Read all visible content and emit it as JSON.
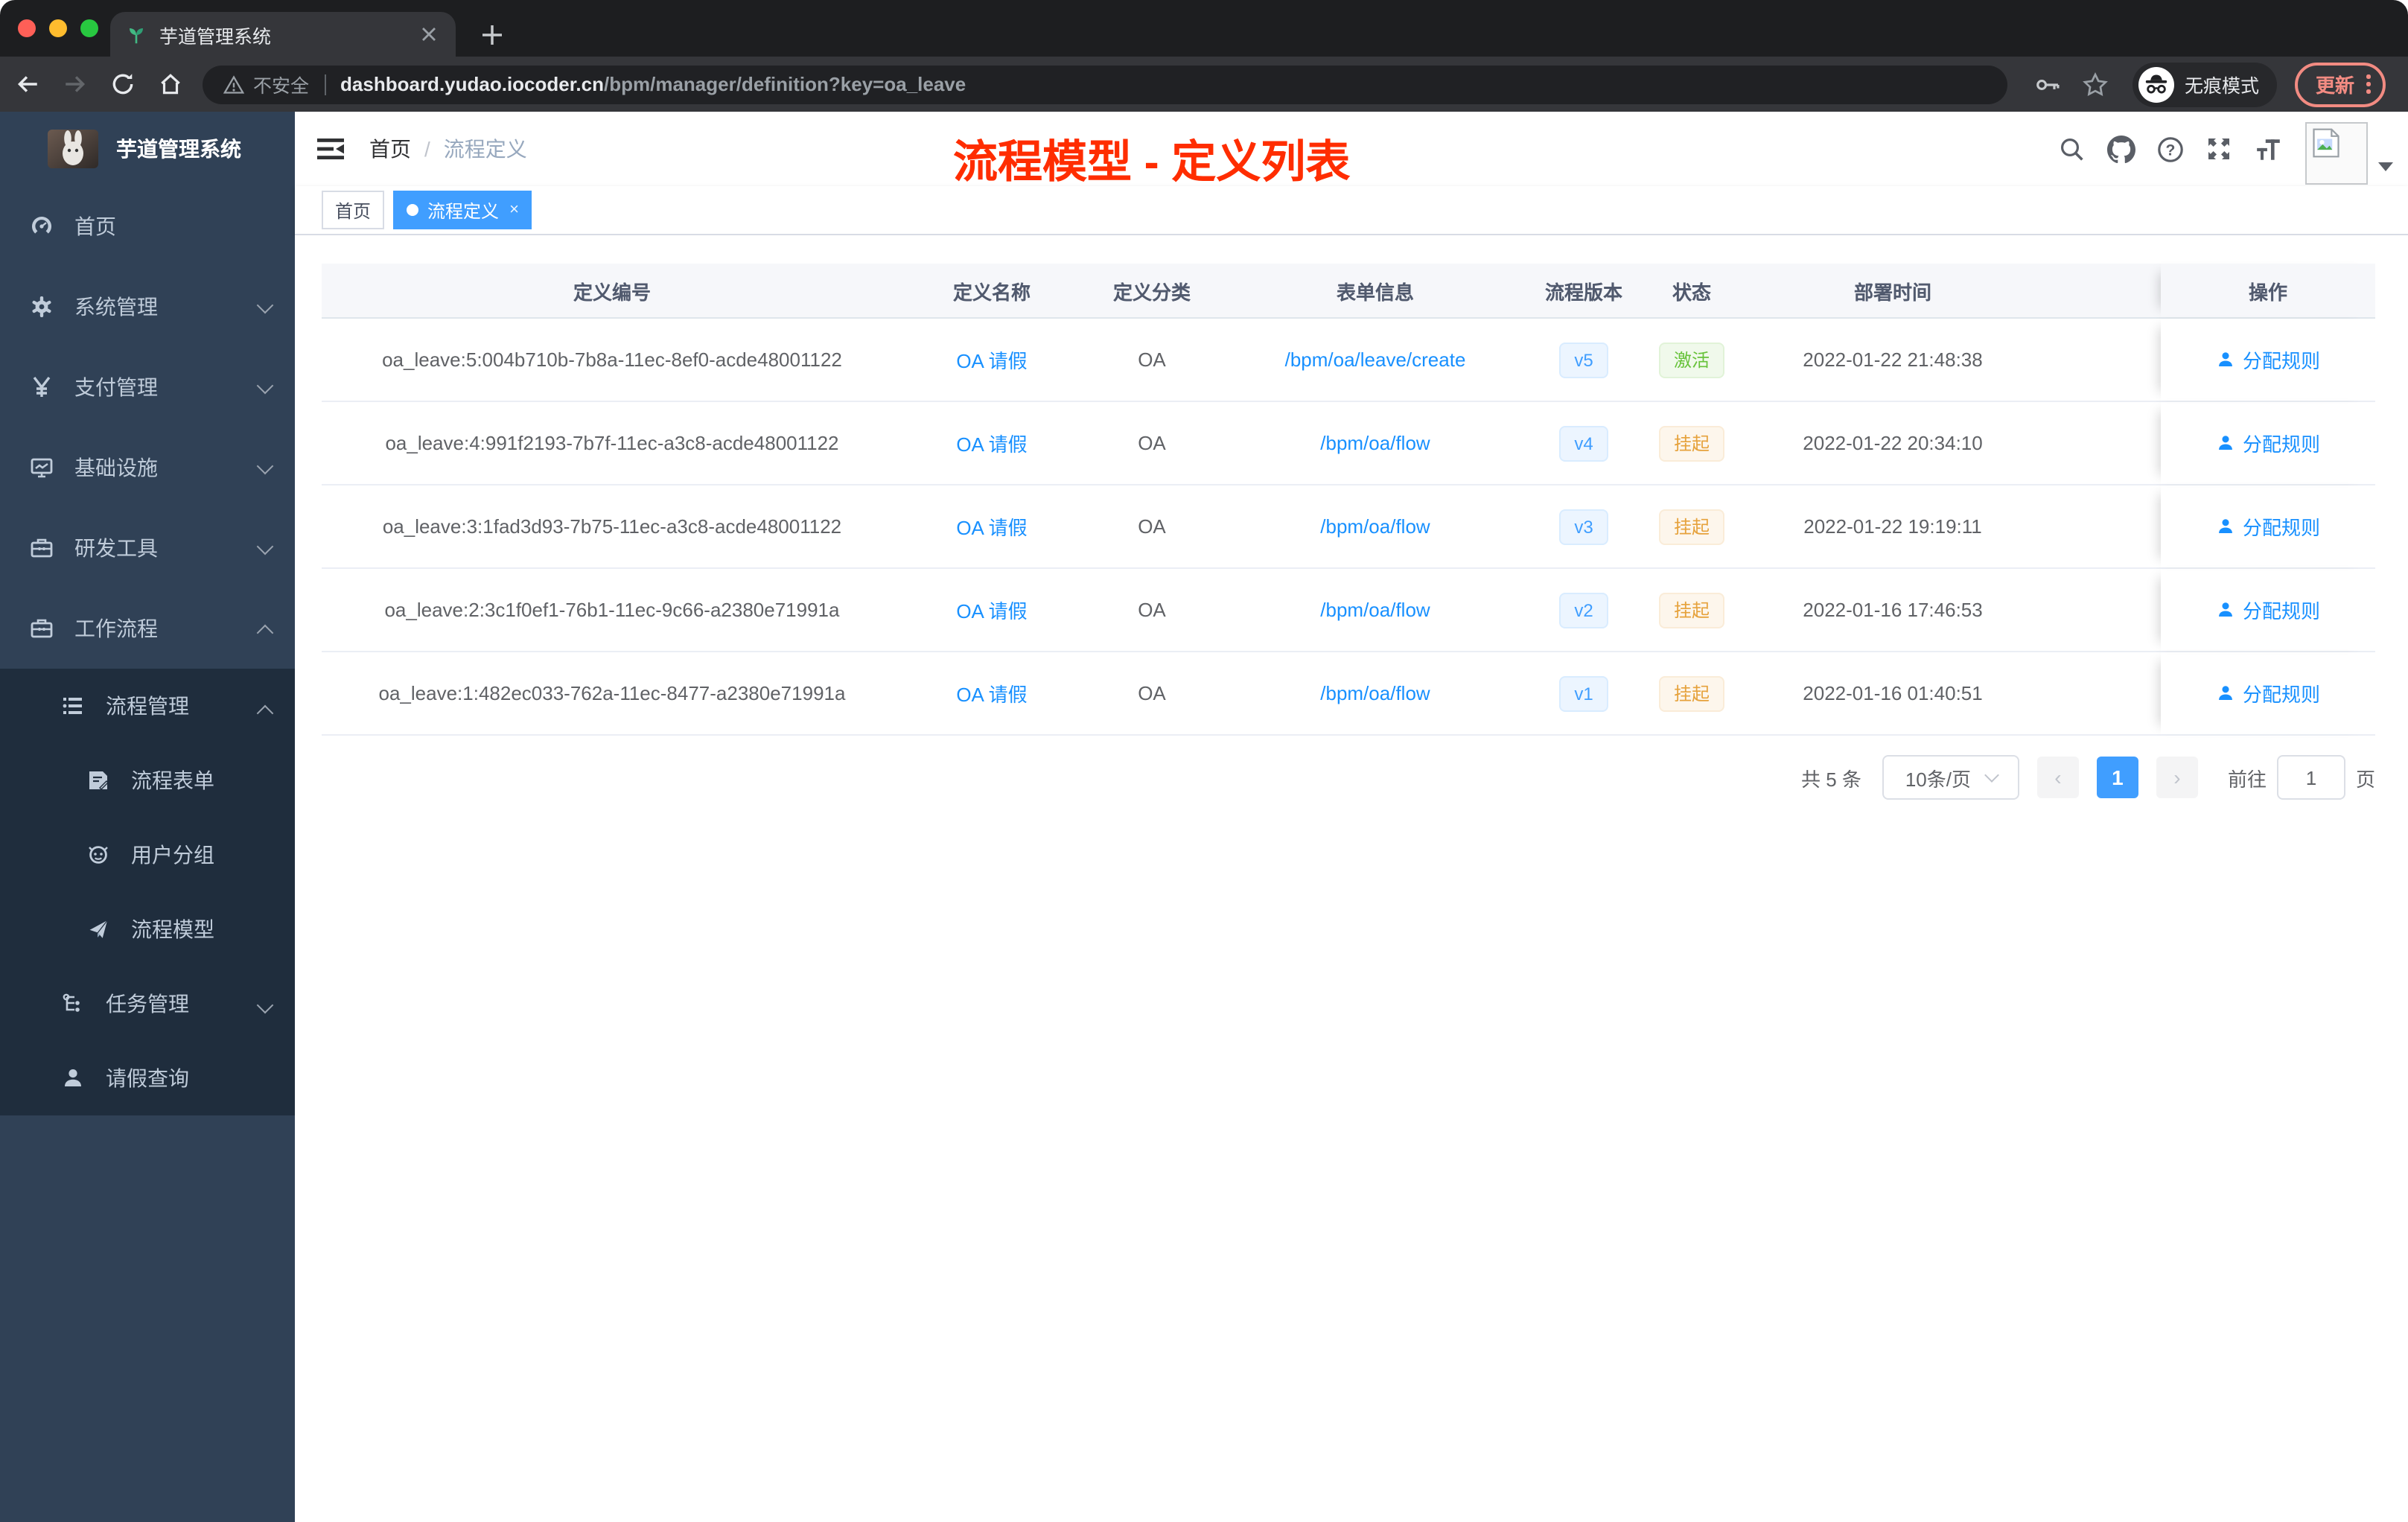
{
  "browser": {
    "tab_title": "芋道管理系统",
    "new_tab_glyph": "+",
    "close_glyph": "×",
    "security_label": "不安全",
    "url_host": "dashboard.yudao.iocoder.cn",
    "url_path": "/bpm/manager/definition?key=oa_leave",
    "incognito_label": "无痕模式",
    "update_label": "更新"
  },
  "sidebar": {
    "app_title": "芋道管理系统",
    "menu": [
      {
        "label": "首页",
        "icon": "dashboard-icon",
        "level": 1
      },
      {
        "label": "系统管理",
        "icon": "gear-icon",
        "level": 1,
        "expanded": false
      },
      {
        "label": "支付管理",
        "icon": "yen-icon",
        "level": 1,
        "expanded": false
      },
      {
        "label": "基础设施",
        "icon": "monitor-icon",
        "level": 1,
        "expanded": false
      },
      {
        "label": "研发工具",
        "icon": "toolbox-icon",
        "level": 1,
        "expanded": false
      },
      {
        "label": "工作流程",
        "icon": "briefcase-icon",
        "level": 1,
        "expanded": true
      },
      {
        "label": "流程管理",
        "icon": "list-icon",
        "level": 2,
        "expanded": true
      },
      {
        "label": "流程表单",
        "icon": "form-icon",
        "level": 3
      },
      {
        "label": "用户分组",
        "icon": "user-group-icon",
        "level": 3
      },
      {
        "label": "流程模型",
        "icon": "paper-plane-icon",
        "level": 3
      },
      {
        "label": "任务管理",
        "icon": "tree-icon",
        "level": 2,
        "expanded": false
      },
      {
        "label": "请假查询",
        "icon": "user-icon",
        "level": 2
      }
    ]
  },
  "navbar": {
    "breadcrumb": {
      "home": "首页",
      "separator": "/",
      "current": "流程定义"
    },
    "annotation": "流程模型 - 定义列表"
  },
  "tags": {
    "home": "首页",
    "active": "流程定义",
    "close_glyph": "×"
  },
  "table": {
    "columns": [
      "定义编号",
      "定义名称",
      "定义分类",
      "表单信息",
      "流程版本",
      "状态",
      "部署时间",
      "操作"
    ],
    "rows": [
      {
        "id": "oa_leave:5:004b710b-7b8a-11ec-8ef0-acde48001122",
        "name": "OA 请假",
        "category": "OA",
        "form": "/bpm/oa/leave/create",
        "version": "v5",
        "status": "激活",
        "status_type": "success",
        "deployed_at": "2022-01-22 21:48:38",
        "action": "分配规则"
      },
      {
        "id": "oa_leave:4:991f2193-7b7f-11ec-a3c8-acde48001122",
        "name": "OA 请假",
        "category": "OA",
        "form": "/bpm/oa/flow",
        "version": "v4",
        "status": "挂起",
        "status_type": "warning",
        "deployed_at": "2022-01-22 20:34:10",
        "action": "分配规则"
      },
      {
        "id": "oa_leave:3:1fad3d93-7b75-11ec-a3c8-acde48001122",
        "name": "OA 请假",
        "category": "OA",
        "form": "/bpm/oa/flow",
        "version": "v3",
        "status": "挂起",
        "status_type": "warning",
        "deployed_at": "2022-01-22 19:19:11",
        "action": "分配规则"
      },
      {
        "id": "oa_leave:2:3c1f0ef1-76b1-11ec-9c66-a2380e71991a",
        "name": "OA 请假",
        "category": "OA",
        "form": "/bpm/oa/flow",
        "version": "v2",
        "status": "挂起",
        "status_type": "warning",
        "deployed_at": "2022-01-16 17:46:53",
        "action": "分配规则"
      },
      {
        "id": "oa_leave:1:482ec033-762a-11ec-8477-a2380e71991a",
        "name": "OA 请假",
        "category": "OA",
        "form": "/bpm/oa/flow",
        "version": "v1",
        "status": "挂起",
        "status_type": "warning",
        "deployed_at": "2022-01-16 01:40:51",
        "action": "分配规则"
      }
    ]
  },
  "pagination": {
    "total": "共 5 条",
    "page_size": "10条/页",
    "prev_glyph": "‹",
    "current_page": "1",
    "next_glyph": "›",
    "goto_label": "前往",
    "goto_value": "1",
    "page_unit": "页"
  },
  "colors": {
    "accent": "#409eff",
    "link": "#1890ff",
    "success": "#67c23a",
    "warning": "#e6a23c",
    "annotation_red": "#ff2d00",
    "sidebar_bg": "#304156",
    "submenu_bg": "#1f2d3d",
    "chrome_bar": "#35363a",
    "update_chip": "#f28b82"
  }
}
